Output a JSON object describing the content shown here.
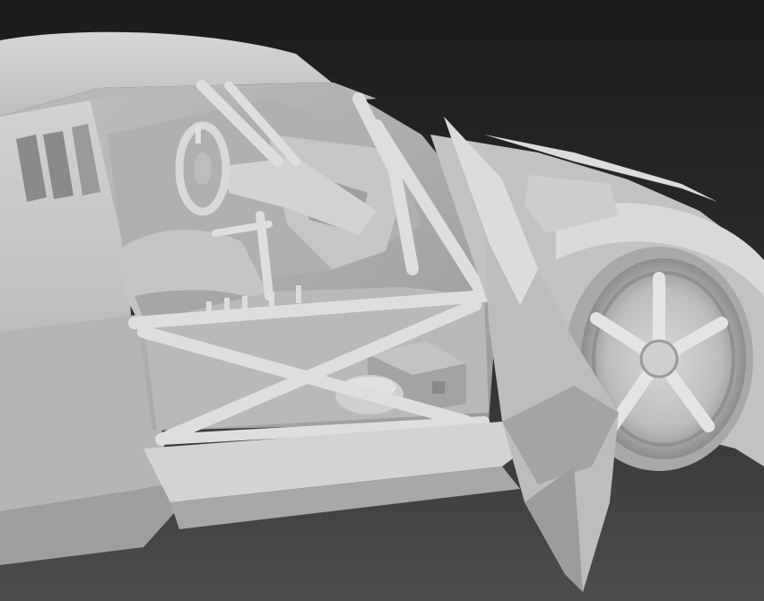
{
  "scene": {
    "subject": "car-render",
    "colors": {
      "bg_top": "#1c1c1c",
      "bg_bottom": "#4a4a4a",
      "body": "#c9c9c9",
      "body_light": "#e2e2e2",
      "shadow": "#8f8f8f",
      "deep_shadow": "#6e6e6e"
    }
  }
}
